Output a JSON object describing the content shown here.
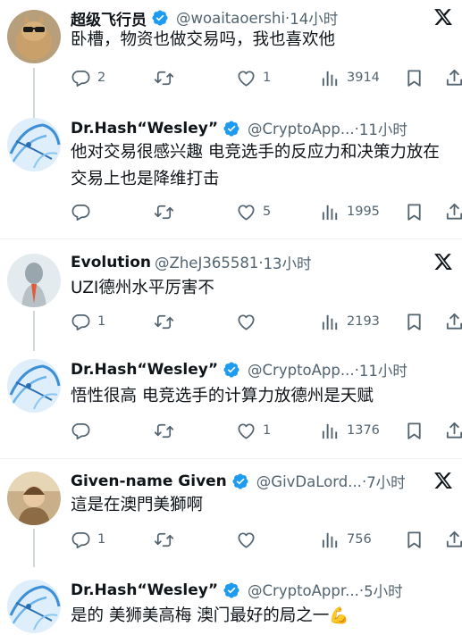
{
  "tweets": [
    {
      "name": "超级飞行员",
      "handle": "@woaitaoershi",
      "sep": "·",
      "time": "14小时",
      "text": "卧槽，物资也做交易吗，我也喜欢他",
      "replies": "2",
      "retweets": "",
      "likes": "1",
      "views": "3914"
    },
    {
      "name": "Dr.Hash“Wesley”",
      "handle": "@CryptoApp...",
      "sep": "·",
      "time": "11小时",
      "text": "他对交易很感兴趣 电竞选手的反应力和决策力放在交易上也是降维打击",
      "replies": "",
      "retweets": "",
      "likes": "5",
      "views": "1995"
    },
    {
      "name": "Evolution",
      "handle": "@ZheJ365581",
      "sep": "·",
      "time": "13小时",
      "text": "UZI德州水平厉害不",
      "replies": "1",
      "retweets": "",
      "likes": "",
      "views": "2193"
    },
    {
      "name": "Dr.Hash“Wesley”",
      "handle": "@CryptoApp...",
      "sep": "·",
      "time": "11小时",
      "text": "悟性很高 电竞选手的计算力放德州是天赋",
      "replies": "",
      "retweets": "",
      "likes": "1",
      "views": "1376"
    },
    {
      "name": "Given-name Given",
      "handle": "@GivDaLord...",
      "sep": "·",
      "time": "7小时",
      "text": "這是在澳門美獅啊",
      "replies": "1",
      "retweets": "",
      "likes": "",
      "views": "756"
    },
    {
      "name": "Dr.Hash“Wesley”",
      "handle": "@CryptoAppr...",
      "sep": "·",
      "time": "5小时",
      "text": "是的 美狮美高梅 澳门最好的局之一",
      "emoji": "💪",
      "replies": "",
      "retweets": "",
      "likes": "",
      "views": ""
    }
  ],
  "icons": {
    "verified": "verified-badge-icon",
    "x": "x-logo-icon",
    "reply": "reply-icon",
    "retweet": "retweet-icon",
    "like": "heart-icon",
    "views": "views-bar-icon",
    "bookmark": "bookmark-icon",
    "share": "share-icon"
  },
  "colors": {
    "verified": "#1d9bf0",
    "text": "#0f1419",
    "muted": "#536471",
    "line": "#cfd9de"
  }
}
